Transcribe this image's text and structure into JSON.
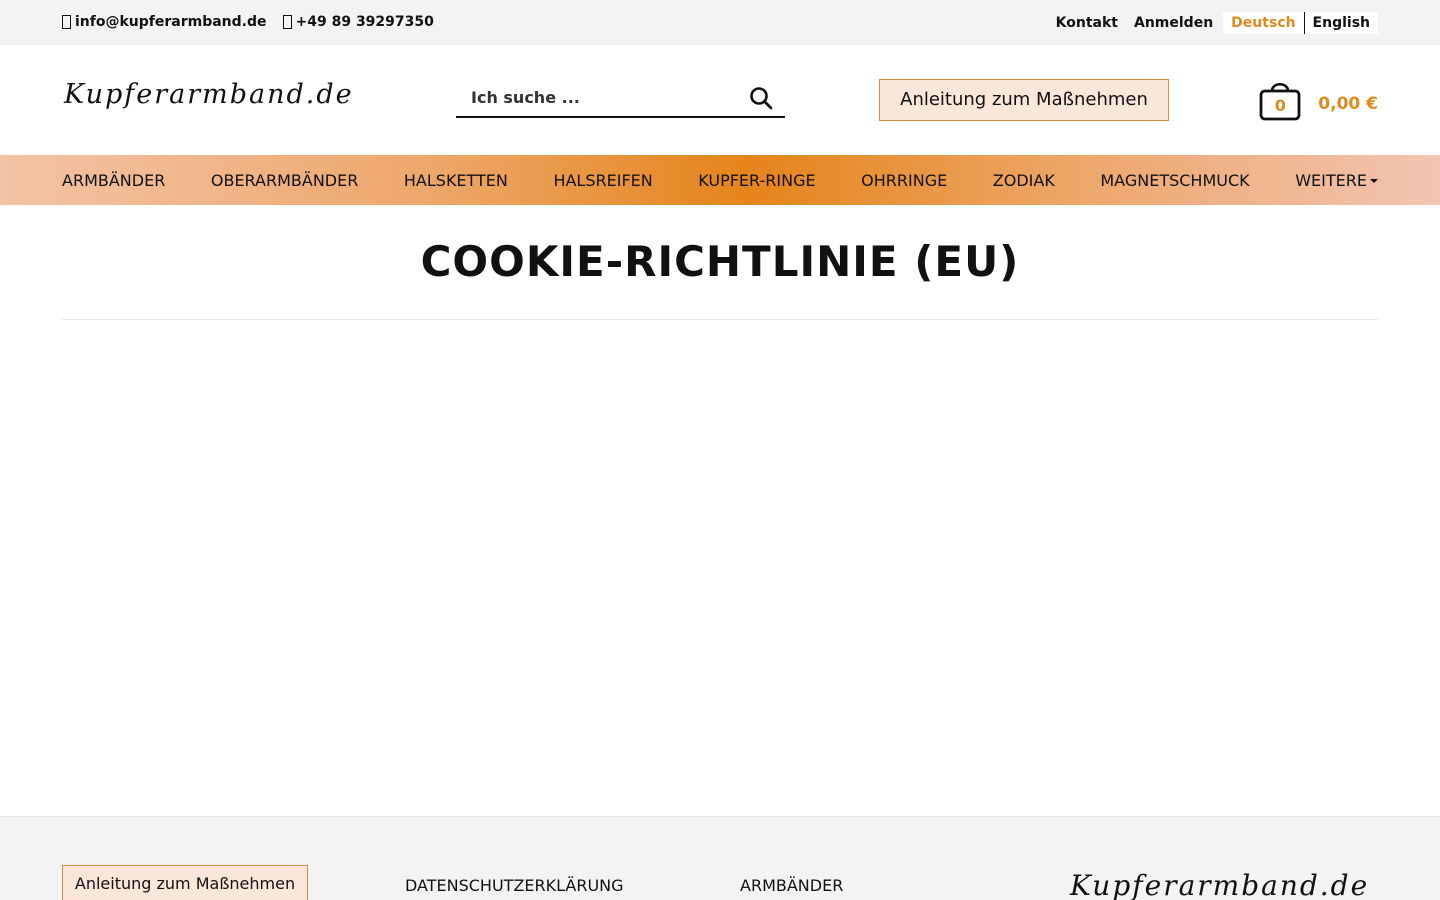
{
  "topbar": {
    "email": "info@kupferarmband.de",
    "phone": "+49 89 39297350",
    "links": [
      "Kontakt",
      "Anmelden"
    ],
    "languages": [
      "Deutsch",
      "English"
    ],
    "active_language": "Deutsch"
  },
  "header": {
    "logo": "Kupferarmband.de",
    "search_placeholder": "Ich suche ...",
    "measure_button": "Anleitung zum Maßnehmen",
    "cart_count": "0",
    "cart_total": "0,00 €"
  },
  "nav": {
    "items": [
      "ARMBÄNDER",
      "OBERARMBÄNDER",
      "HALSKETTEN",
      "HALSREIFEN",
      "KUPFER-RINGE",
      "OHRRINGE",
      "ZODIAK",
      "MAGNETSCHMUCK",
      "WEITERE"
    ]
  },
  "main": {
    "title": "COOKIE-RICHTLINIE (EU)"
  },
  "footer": {
    "measure_button": "Anleitung zum Maßnehmen",
    "link_privacy": "DATENSCHUTZERKLÄRUNG",
    "link_bracelets": "ARMBÄNDER",
    "logo": "Kupferarmband.de"
  },
  "colors": {
    "accent": "#e08a1e",
    "button_bg": "#fbe6da",
    "button_border": "#d98c3c",
    "topbar_bg": "#f3f3f3"
  },
  "icons": {
    "email": "mail-icon",
    "phone": "phone-icon",
    "search": "search-icon",
    "cart": "shopping-bag-icon",
    "dropdown": "caret-down-icon"
  }
}
